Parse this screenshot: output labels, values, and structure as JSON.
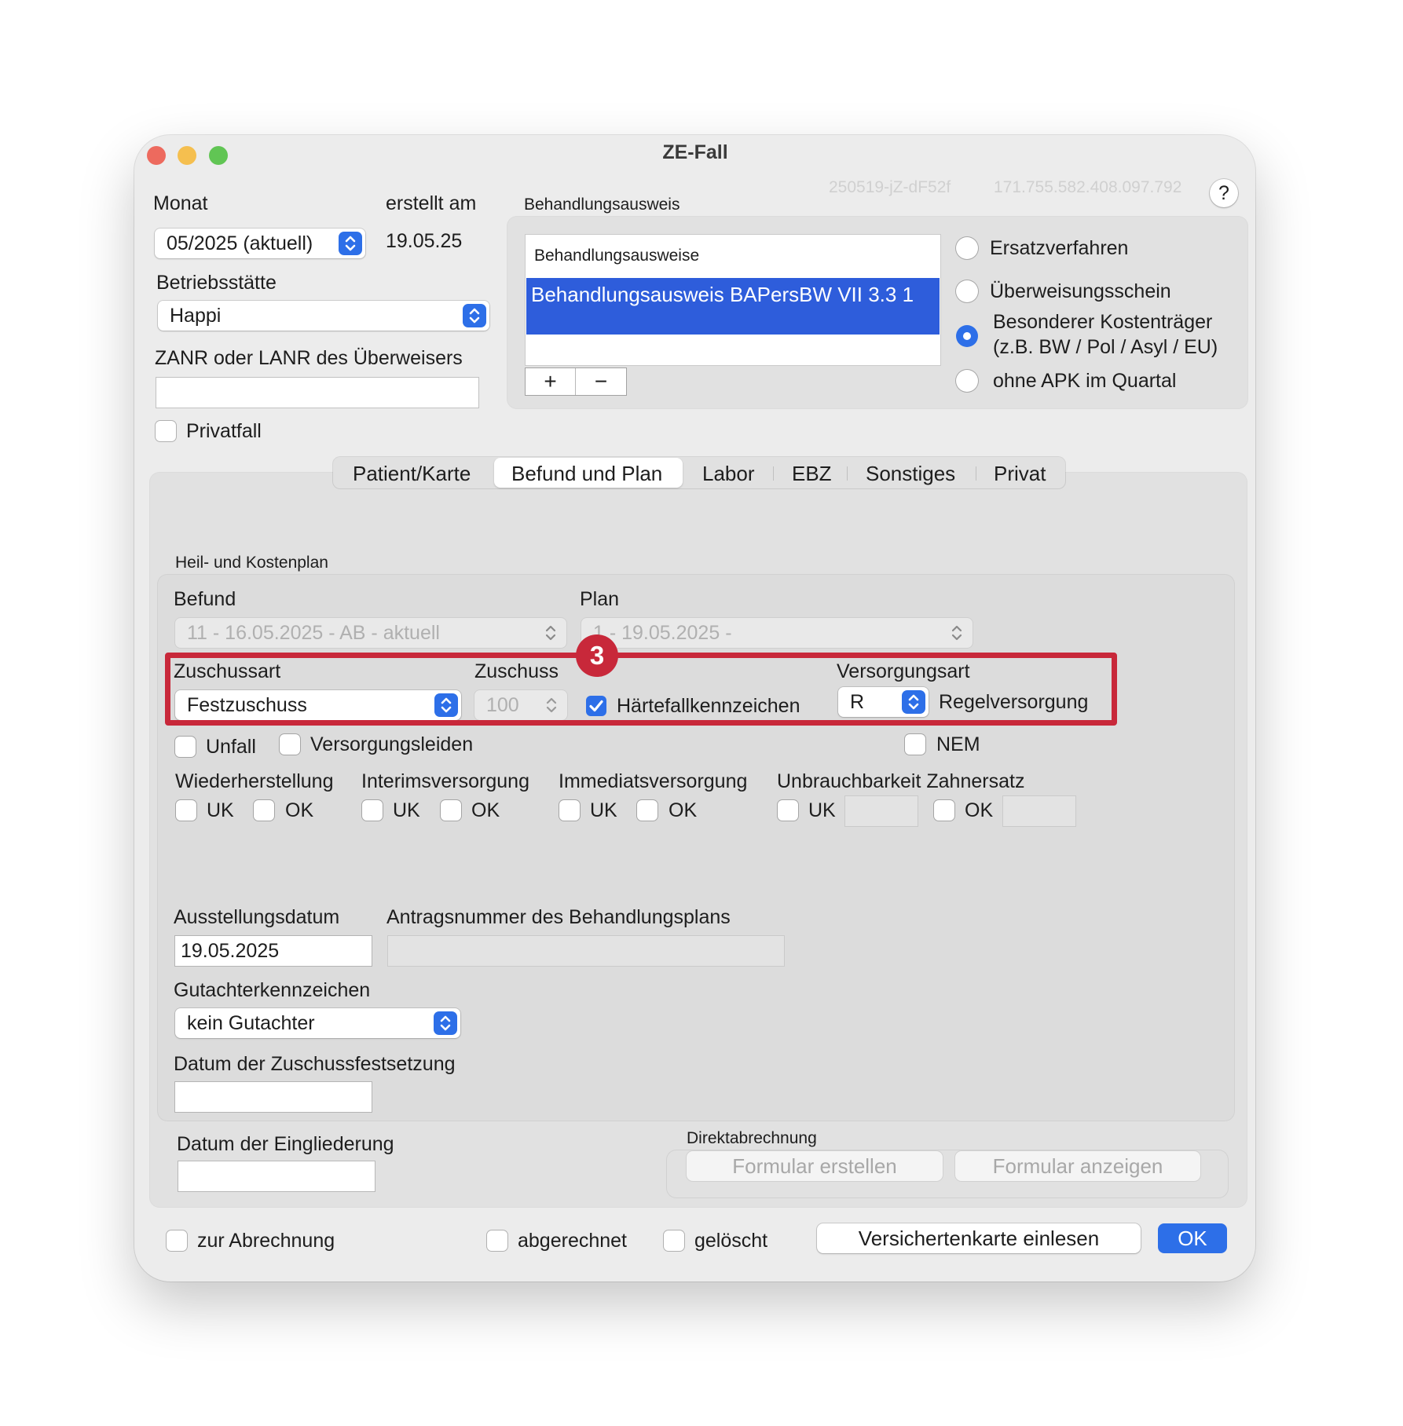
{
  "window": {
    "title": "ZE-Fall",
    "id_code": "250519-jZ-dF52f",
    "id_number": "171.755.582.408.097.792",
    "help_label": "?"
  },
  "header": {
    "monat_label": "Monat",
    "monat_value": "05/2025 (aktuell)",
    "erstellt_label": "erstellt am",
    "erstellt_value": "19.05.25",
    "betriebsstaette_label": "Betriebsstätte",
    "betriebsstaette_value": "Happi",
    "zanr_label": "ZANR oder LANR des Überweisers",
    "zanr_value": "",
    "privatfall_label": "Privatfall"
  },
  "behandlungsausweis": {
    "group_label": "Behandlungsausweis",
    "list_header": "Behandlungsausweise",
    "items": [
      "Behandlungsausweis BAPersBW VII 3.3 1"
    ],
    "add_label": "+",
    "remove_label": "−",
    "radios": [
      {
        "label": "Ersatzverfahren",
        "selected": false
      },
      {
        "label": "Überweisungsschein",
        "selected": false
      },
      {
        "label": "Besonderer Kostenträger",
        "label2": "(z.B. BW / Pol / Asyl / EU)",
        "selected": true
      },
      {
        "label": "ohne APK im Quartal",
        "selected": false
      }
    ]
  },
  "tabs": [
    {
      "label": "Patient/Karte"
    },
    {
      "label": "Befund und Plan",
      "selected": true
    },
    {
      "label": "Labor"
    },
    {
      "label": "EBZ"
    },
    {
      "label": "Sonstiges"
    },
    {
      "label": "Privat"
    }
  ],
  "hkp": {
    "group_label": "Heil- und Kostenplan",
    "befund_label": "Befund",
    "befund_value": "11 - 16.05.2025 - AB - aktuell",
    "plan_label": "Plan",
    "plan_value": "1 - 19.05.2025 -",
    "zuschussart_label": "Zuschussart",
    "zuschussart_value": "Festzuschuss",
    "zuschuss_label": "Zuschuss",
    "zuschuss_value": "100",
    "haertefall_label": "Härtefallkennzeichen",
    "versorgungsart_label": "Versorgungsart",
    "versorgungsart_value": "R",
    "versorgungsart_desc": "Regelversorgung",
    "annotation_number": "3",
    "annotation_color": "#c8283a",
    "unfall_label": "Unfall",
    "versorgungsleiden_label": "Versorgungsleiden",
    "nem_label": "NEM",
    "wiederherstellung_label": "Wiederherstellung",
    "interimsversorgung_label": "Interimsversorgung",
    "immediatsversorgung_label": "Immediatsversorgung",
    "unbrauchbarkeit_label": "Unbrauchbarkeit Zahnersatz",
    "uk_label": "UK",
    "ok_label": "OK",
    "ausstellungsdatum_label": "Ausstellungsdatum",
    "ausstellungsdatum_value": "19.05.2025",
    "antragsnummer_label": "Antragsnummer des Behandlungsplans",
    "antragsnummer_value": "",
    "gutachter_label": "Gutachterkennzeichen",
    "gutachter_value": "kein Gutachter",
    "zuschussfestsetzung_label": "Datum der Zuschussfestsetzung",
    "zuschussfestsetzung_value": ""
  },
  "lower": {
    "eingliederung_label": "Datum der Eingliederung",
    "eingliederung_value": "",
    "direktabrechnung_label": "Direktabrechnung",
    "formular_erstellen_label": "Formular erstellen",
    "formular_anzeigen_label": "Formular anzeigen"
  },
  "footer": {
    "zur_abrechnung_label": "zur Abrechnung",
    "abgerechnet_label": "abgerechnet",
    "geloescht_label": "gelöscht",
    "versichertenkarte_label": "Versichertenkarte einlesen",
    "ok_button_label": "OK"
  },
  "colors": {
    "accent": "#2d6fe8",
    "traffic_close": "#ed6a5e",
    "traffic_minimize": "#f5bf4f",
    "traffic_zoom": "#61c554"
  }
}
